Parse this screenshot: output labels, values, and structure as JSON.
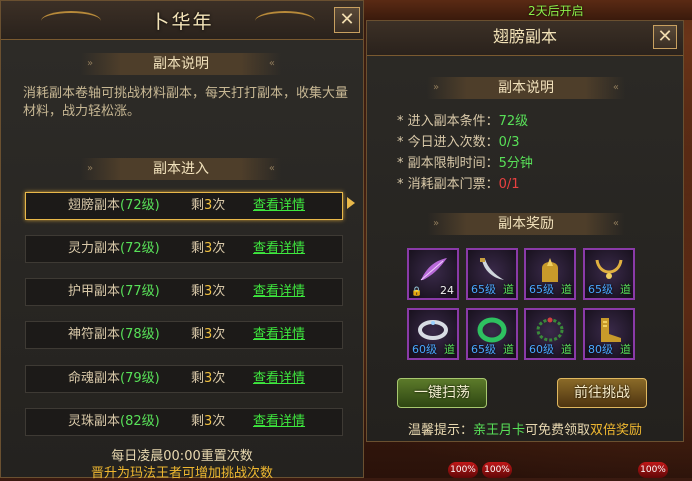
{
  "background": {
    "countdown": "2天后开启"
  },
  "left_panel": {
    "title": "卜华年",
    "close_label": "✕",
    "desc_header": "副本说明",
    "desc_text": "消耗副本卷轴可挑战材料副本，每天打打副本，收集大量材料，战力轻松涨。",
    "entry_header": "副本进入",
    "dungeons": [
      {
        "name": "翅膀副本",
        "level": "(72级)",
        "remain_prefix": "剩",
        "remain": "3",
        "remain_suffix": "次",
        "detail": "查看详情"
      },
      {
        "name": "灵力副本",
        "level": "(72级)",
        "remain_prefix": "剩",
        "remain": "3",
        "remain_suffix": "次",
        "detail": "查看详情"
      },
      {
        "name": "护甲副本",
        "level": "(77级)",
        "remain_prefix": "剩",
        "remain": "3",
        "remain_suffix": "次",
        "detail": "查看详情"
      },
      {
        "name": "神符副本",
        "level": "(78级)",
        "remain_prefix": "剩",
        "remain": "3",
        "remain_suffix": "次",
        "detail": "查看详情"
      },
      {
        "name": "命魂副本",
        "level": "(79级)",
        "remain_prefix": "剩",
        "remain": "3",
        "remain_suffix": "次",
        "detail": "查看详情"
      },
      {
        "name": "灵珠副本",
        "level": "(82级)",
        "remain_prefix": "剩",
        "remain": "3",
        "remain_suffix": "次",
        "detail": "查看详情"
      }
    ],
    "selected_index": 0,
    "footer_reset": "每日凌晨00:00重置次数",
    "footer_upgrade": "晋升为玛法王者可增加挑战次数"
  },
  "right_panel": {
    "title": "翅膀副本",
    "close_label": "✕",
    "desc_header": "副本说明",
    "info": [
      {
        "label": "* 进入副本条件：",
        "value": "72级",
        "color": "green"
      },
      {
        "label": "* 今日进入次数：",
        "value": "0/3",
        "color": "green"
      },
      {
        "label": "* 副本限制时间：",
        "value": "5分钟",
        "color": "green"
      },
      {
        "label": "* 消耗副本门票：",
        "value": "0/1",
        "color": "red"
      }
    ],
    "reward_header": "副本奖励",
    "rewards": [
      {
        "icon": "feather-icon",
        "level": "",
        "count": "24",
        "tag": ""
      },
      {
        "icon": "curved-blade-icon",
        "level": "65级",
        "count": "",
        "tag": "道"
      },
      {
        "icon": "golden-helmet-icon",
        "level": "65级",
        "count": "",
        "tag": "道"
      },
      {
        "icon": "gold-necklace-icon",
        "level": "65级",
        "count": "",
        "tag": "道"
      },
      {
        "icon": "silver-bracelet-icon",
        "level": "60级",
        "count": "",
        "tag": "道"
      },
      {
        "icon": "jade-bangle-icon",
        "level": "65级",
        "count": "",
        "tag": "道"
      },
      {
        "icon": "bead-bracelet-icon",
        "level": "60级",
        "count": "",
        "tag": "道"
      },
      {
        "icon": "gold-boots-icon",
        "level": "80级",
        "count": "",
        "tag": "道"
      }
    ],
    "sweep_button": "一键扫荡",
    "challenge_button": "前往挑战",
    "tip_prefix": "温馨提示：",
    "tip_card": "亲王月卡",
    "tip_middle": "可免费领取",
    "tip_reward": "双倍奖励"
  },
  "hp_labels": [
    "100%",
    "100%",
    "100%"
  ]
}
